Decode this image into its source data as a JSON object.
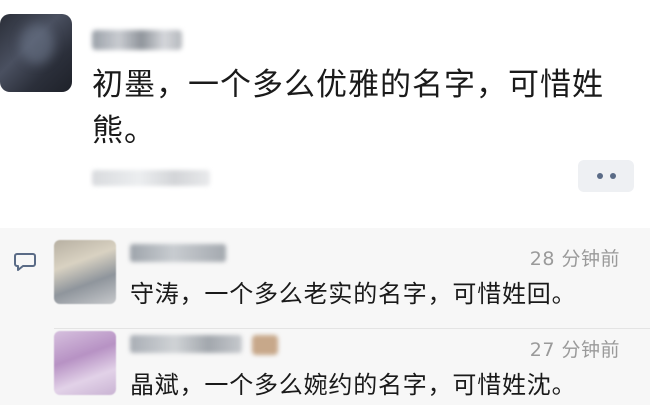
{
  "post": {
    "text": "初墨，一个多么优雅的名字，可惜姓熊。",
    "more_icon": "more-dots-icon"
  },
  "comments_section": {
    "comment_icon": "speech-bubble-icon",
    "items": [
      {
        "time": "28 分钟前",
        "text": "守涛，一个多么老实的名字，可惜姓回。"
      },
      {
        "time": "27 分钟前",
        "text": "晶斌，一个多么婉约的名字，可惜姓沈。"
      }
    ]
  },
  "colors": {
    "background": "#ffffff",
    "comments_background": "#f7f7f7",
    "text": "#1a1a1a",
    "timestamp": "#9a9a9a",
    "link_blue": "#5a6b86"
  }
}
